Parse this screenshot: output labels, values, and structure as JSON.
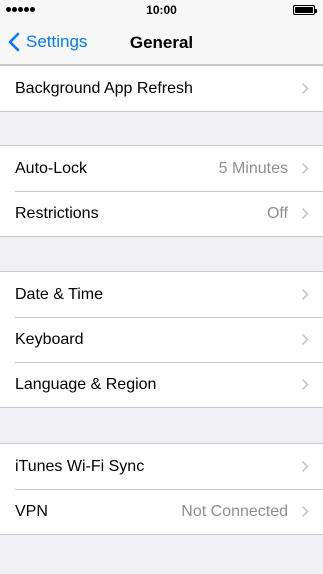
{
  "status_bar": {
    "signal_icon": "signal-dots-icon",
    "time": "10:00",
    "battery_icon": "battery-full-icon"
  },
  "nav": {
    "back_label": "Settings",
    "title": "General"
  },
  "groups": [
    {
      "rows": [
        {
          "label": "Background App Refresh",
          "value": ""
        }
      ]
    },
    {
      "rows": [
        {
          "label": "Auto-Lock",
          "value": "5 Minutes"
        },
        {
          "label": "Restrictions",
          "value": "Off"
        }
      ]
    },
    {
      "rows": [
        {
          "label": "Date & Time",
          "value": ""
        },
        {
          "label": "Keyboard",
          "value": ""
        },
        {
          "label": "Language & Region",
          "value": ""
        }
      ]
    },
    {
      "rows": [
        {
          "label": "iTunes Wi-Fi Sync",
          "value": ""
        },
        {
          "label": "VPN",
          "value": "Not Connected"
        }
      ]
    }
  ],
  "colors": {
    "accent": "#007aff",
    "background": "#efeff4",
    "secondary_text": "#8e8e93",
    "separator": "#c8c7cc",
    "chevron": "#c7c7cc"
  }
}
